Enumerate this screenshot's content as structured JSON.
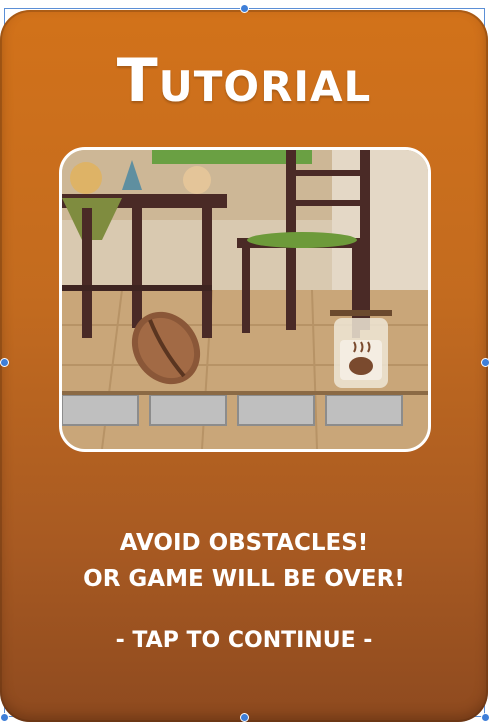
{
  "title": "Tutorial",
  "message": {
    "line1": "AVOID OBSTACLES!",
    "line2": "OR GAME WILL BE OVER!"
  },
  "prompt": "- TAP TO CONTINUE -",
  "icons": {
    "player": "coffee-bean-icon",
    "goal": "coffee-jar-icon",
    "platform": "stone-block-icon"
  },
  "colors": {
    "card_top": "#d2721a",
    "card_bottom": "#8e4a1f",
    "text": "#ffffff",
    "selection": "#3f7fd8"
  }
}
